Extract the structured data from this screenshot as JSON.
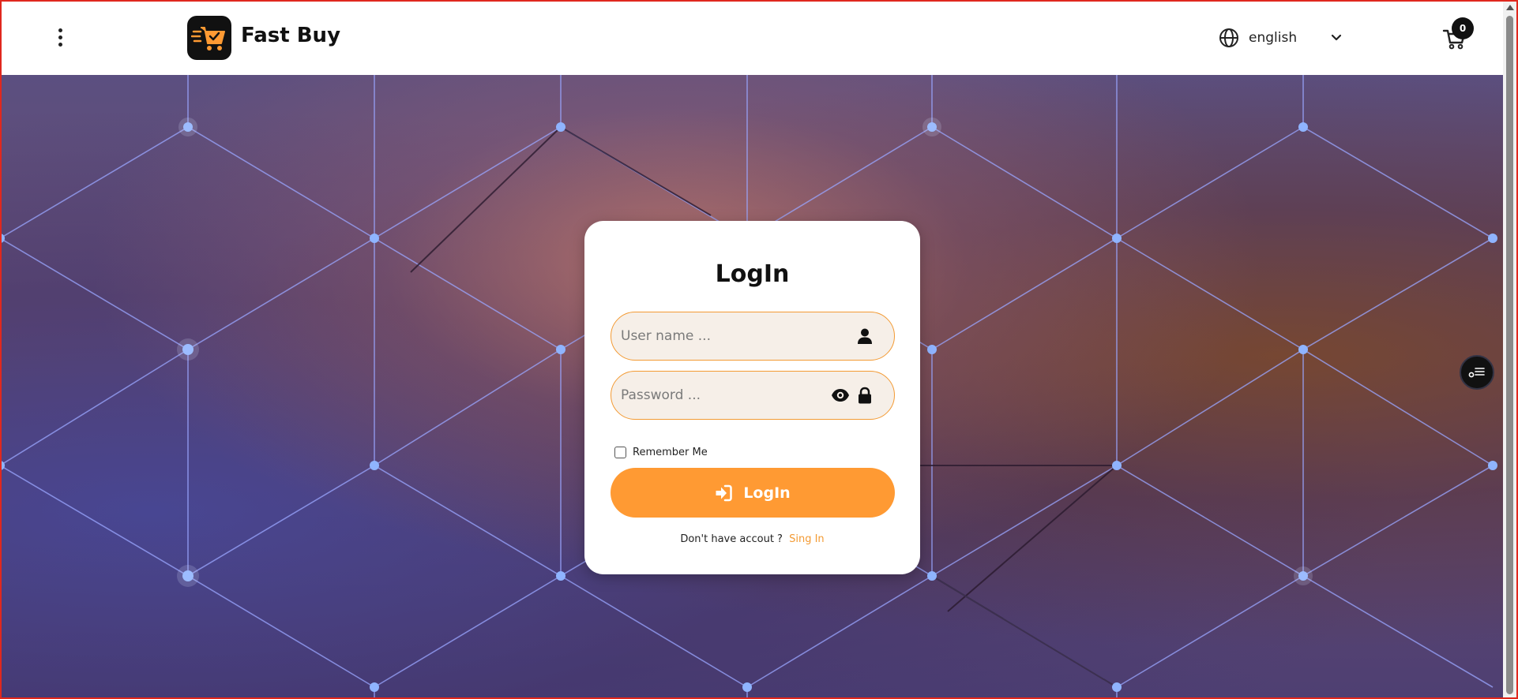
{
  "header": {
    "brand": "Fast Buy",
    "language": "english",
    "cart_count": "0"
  },
  "login": {
    "title": "LogIn",
    "username_placeholder": "User name ...",
    "password_placeholder": "Password ...",
    "remember_label": "Remember Me",
    "submit_label": "LogIn",
    "signup_prompt": "Don't have accout ?",
    "signup_link": "Sing In"
  },
  "colors": {
    "accent": "#ff9a33",
    "field_border": "#f39a33",
    "field_bg": "#f6efe8"
  },
  "icons": {
    "menu": "kebab-menu-icon",
    "logo": "cart-logo-icon",
    "language": "globe-icon",
    "language_toggle": "chevron-down-icon",
    "cart": "cart-icon",
    "username": "user-icon",
    "password_toggle": "eye-icon",
    "password": "lock-icon",
    "submit": "sign-in-icon",
    "widget": "settings-list-icon"
  }
}
